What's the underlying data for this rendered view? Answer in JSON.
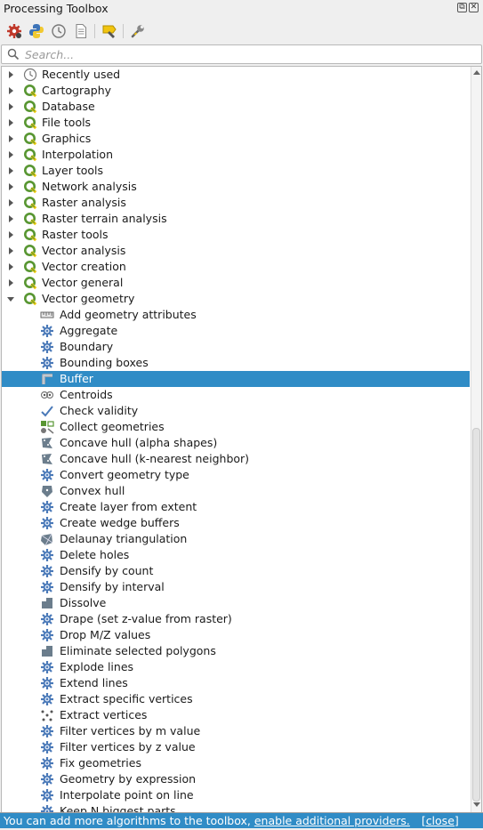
{
  "panel": {
    "title": "Processing Toolbox",
    "float_icon": "⧉",
    "close_icon": "✕"
  },
  "toolbar": [
    {
      "name": "models-button",
      "icon": "models-icon"
    },
    {
      "name": "scripts-button",
      "icon": "python-icon"
    },
    {
      "name": "history-button",
      "icon": "history-icon"
    },
    {
      "name": "results-viewer-button",
      "icon": "results-icon"
    },
    {
      "name": "edit-features-in-place-button",
      "icon": "edit-in-place-icon"
    },
    {
      "name": "options-button",
      "icon": "wrench-icon"
    }
  ],
  "search": {
    "placeholder": "Search...",
    "value": ""
  },
  "groups": [
    {
      "label": "Recently used",
      "icon": "clock-icon",
      "expanded": false
    },
    {
      "label": "Cartography",
      "icon": "qgis-icon",
      "expanded": false
    },
    {
      "label": "Database",
      "icon": "qgis-icon",
      "expanded": false
    },
    {
      "label": "File tools",
      "icon": "qgis-icon",
      "expanded": false
    },
    {
      "label": "Graphics",
      "icon": "qgis-icon",
      "expanded": false
    },
    {
      "label": "Interpolation",
      "icon": "qgis-icon",
      "expanded": false
    },
    {
      "label": "Layer tools",
      "icon": "qgis-icon",
      "expanded": false
    },
    {
      "label": "Network analysis",
      "icon": "qgis-icon",
      "expanded": false
    },
    {
      "label": "Raster analysis",
      "icon": "qgis-icon",
      "expanded": false
    },
    {
      "label": "Raster terrain analysis",
      "icon": "qgis-icon",
      "expanded": false
    },
    {
      "label": "Raster tools",
      "icon": "qgis-icon",
      "expanded": false
    },
    {
      "label": "Vector analysis",
      "icon": "qgis-icon",
      "expanded": false
    },
    {
      "label": "Vector creation",
      "icon": "qgis-icon",
      "expanded": false
    },
    {
      "label": "Vector general",
      "icon": "qgis-icon",
      "expanded": false
    },
    {
      "label": "Vector geometry",
      "icon": "qgis-icon",
      "expanded": true
    }
  ],
  "algorithms": [
    {
      "label": "Add geometry attributes",
      "icon": "ruler-icon"
    },
    {
      "label": "Aggregate",
      "icon": "gear-icon"
    },
    {
      "label": "Boundary",
      "icon": "gear-icon"
    },
    {
      "label": "Bounding boxes",
      "icon": "gear-icon"
    },
    {
      "label": "Buffer",
      "icon": "buffer-icon",
      "selected": true
    },
    {
      "label": "Centroids",
      "icon": "centroids-icon"
    },
    {
      "label": "Check validity",
      "icon": "check-icon"
    },
    {
      "label": "Collect geometries",
      "icon": "collect-icon"
    },
    {
      "label": "Concave hull (alpha shapes)",
      "icon": "concave-hull-icon"
    },
    {
      "label": "Concave hull (k-nearest neighbor)",
      "icon": "concave-hull-icon"
    },
    {
      "label": "Convert geometry type",
      "icon": "gear-icon"
    },
    {
      "label": "Convex hull",
      "icon": "convex-hull-icon"
    },
    {
      "label": "Create layer from extent",
      "icon": "gear-icon"
    },
    {
      "label": "Create wedge buffers",
      "icon": "gear-icon"
    },
    {
      "label": "Delaunay triangulation",
      "icon": "delaunay-icon"
    },
    {
      "label": "Delete holes",
      "icon": "gear-icon"
    },
    {
      "label": "Densify by count",
      "icon": "gear-icon"
    },
    {
      "label": "Densify by interval",
      "icon": "gear-icon"
    },
    {
      "label": "Dissolve",
      "icon": "dissolve-icon"
    },
    {
      "label": "Drape (set z-value from raster)",
      "icon": "gear-icon"
    },
    {
      "label": "Drop M/Z values",
      "icon": "gear-icon"
    },
    {
      "label": "Eliminate selected polygons",
      "icon": "dissolve-icon"
    },
    {
      "label": "Explode lines",
      "icon": "gear-icon"
    },
    {
      "label": "Extend lines",
      "icon": "gear-icon"
    },
    {
      "label": "Extract specific vertices",
      "icon": "gear-icon"
    },
    {
      "label": "Extract vertices",
      "icon": "vertices-icon"
    },
    {
      "label": "Filter vertices by m value",
      "icon": "gear-icon"
    },
    {
      "label": "Filter vertices by z value",
      "icon": "gear-icon"
    },
    {
      "label": "Fix geometries",
      "icon": "gear-icon"
    },
    {
      "label": "Geometry by expression",
      "icon": "gear-icon"
    },
    {
      "label": "Interpolate point on line",
      "icon": "gear-icon"
    },
    {
      "label": "Keep N biggest parts",
      "icon": "gear-icon"
    }
  ],
  "infobar": {
    "text": "You can add more algorithms to the toolbox,",
    "link": "enable additional providers.",
    "close": "[close]"
  },
  "colors": {
    "selection": "#308cc6",
    "qgis_green": "#589632",
    "qgis_yellow": "#eec90d",
    "gear_blue": "#4a79b8"
  }
}
